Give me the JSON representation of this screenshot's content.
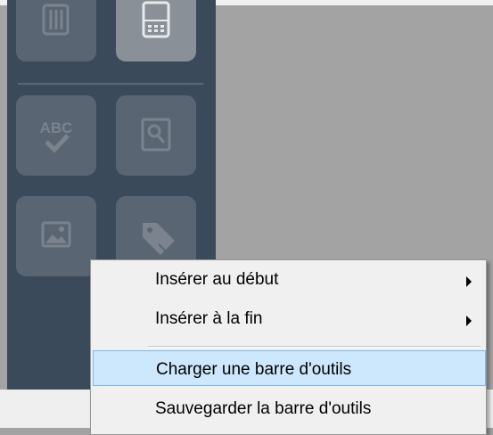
{
  "toolbar": {
    "tiles": [
      {
        "name": "trash-icon",
        "enabled": false
      },
      {
        "name": "mobile-phone-icon",
        "enabled": true
      },
      {
        "name": "spell-check-icon",
        "enabled": false
      },
      {
        "name": "search-document-icon",
        "enabled": false
      },
      {
        "name": "image-icon",
        "enabled": false
      },
      {
        "name": "tag-icon",
        "enabled": false
      }
    ],
    "spellcheck_glyph": "ABC"
  },
  "context_menu": {
    "items": [
      {
        "label": "Insérer au début",
        "has_submenu": true
      },
      {
        "label": "Insérer à la fin",
        "has_submenu": true
      },
      {
        "label": "Charger une barre d'outils",
        "has_submenu": false,
        "highlighted": true
      },
      {
        "label": "Sauvegarder la barre d'outils",
        "has_submenu": false
      }
    ]
  },
  "colors": {
    "panel": "#3b4a5b",
    "tile_disabled": "#5a6573",
    "tile_enabled": "#8a9097",
    "menu_highlight": "#cde8fd",
    "menu_highlight_border": "#7eb4ea"
  }
}
